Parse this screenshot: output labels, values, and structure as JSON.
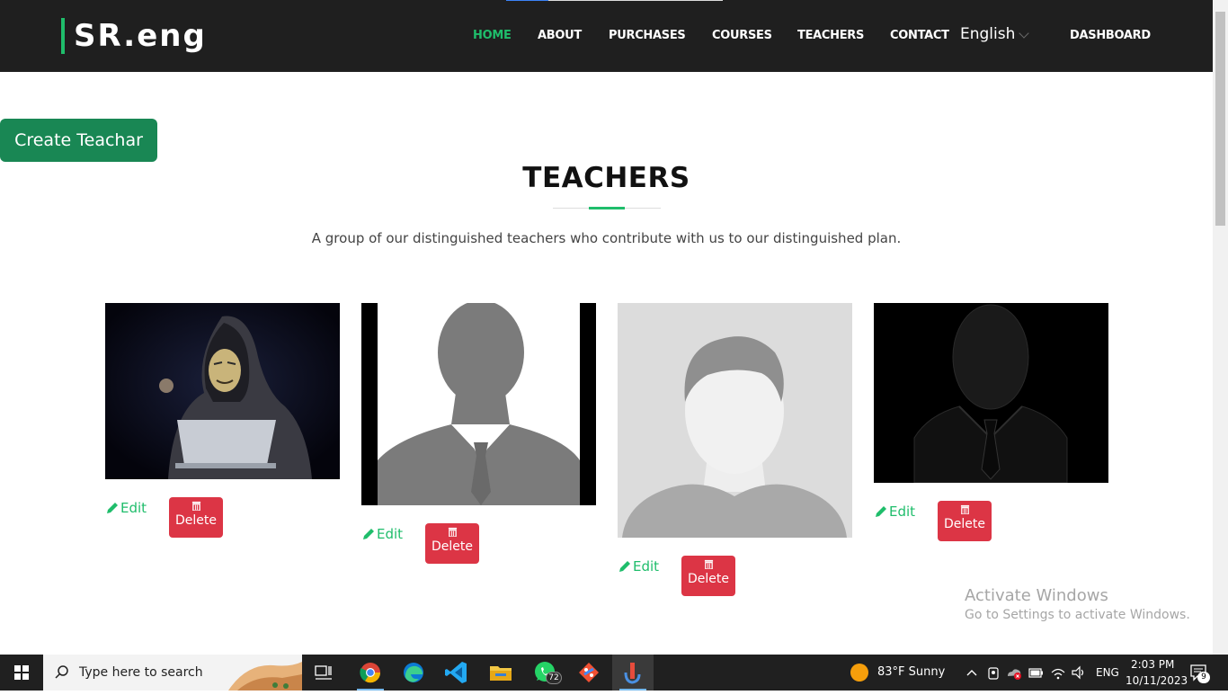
{
  "navbar": {
    "brand": "SR.eng",
    "links": [
      "HOME",
      "ABOUT",
      "PURCHASES",
      "COURSES",
      "TEACHERS",
      "CONTACT"
    ],
    "language": "English",
    "dashboard": "DASHBOARD",
    "active_color": "#1fbd6b"
  },
  "page": {
    "create_button": "Create Teachar",
    "title": "TEACHERS",
    "subtitle": "A group of our distinguished teachers who contribute with us to our distinguished plan."
  },
  "teachers": [
    {
      "photo": "hooded-masked-figure-at-laptop",
      "edit_label": "Edit",
      "delete_label": "Delete"
    },
    {
      "photo": "grey-suit-silhouette-placeholder",
      "edit_label": "Edit",
      "delete_label": "Delete"
    },
    {
      "photo": "male-avatar-placeholder",
      "edit_label": "Edit",
      "delete_label": "Delete"
    },
    {
      "photo": "black-suit-silhouette",
      "edit_label": "Edit",
      "delete_label": "Delete"
    }
  ],
  "watermark": {
    "line1": "Activate Windows",
    "line2": "Go to Settings to activate Windows."
  },
  "taskbar": {
    "search_placeholder": "Type here to search",
    "apps": [
      "chrome-icon",
      "edge-icon",
      "vscode-icon",
      "file-explorer-icon",
      "whatsapp-icon",
      "git-icon",
      "app-icon"
    ],
    "whatsapp_badge": "72",
    "weather": "83°F  Sunny",
    "language": "ENG",
    "time": "2:03 PM",
    "date": "10/11/2023",
    "notification_count": "9"
  },
  "colors": {
    "navbar_bg": "#1f1f1f",
    "accent_green": "#1fbd6b",
    "create_button": "#198754",
    "delete_button": "#dc3545",
    "taskbar_bg": "#202020"
  }
}
